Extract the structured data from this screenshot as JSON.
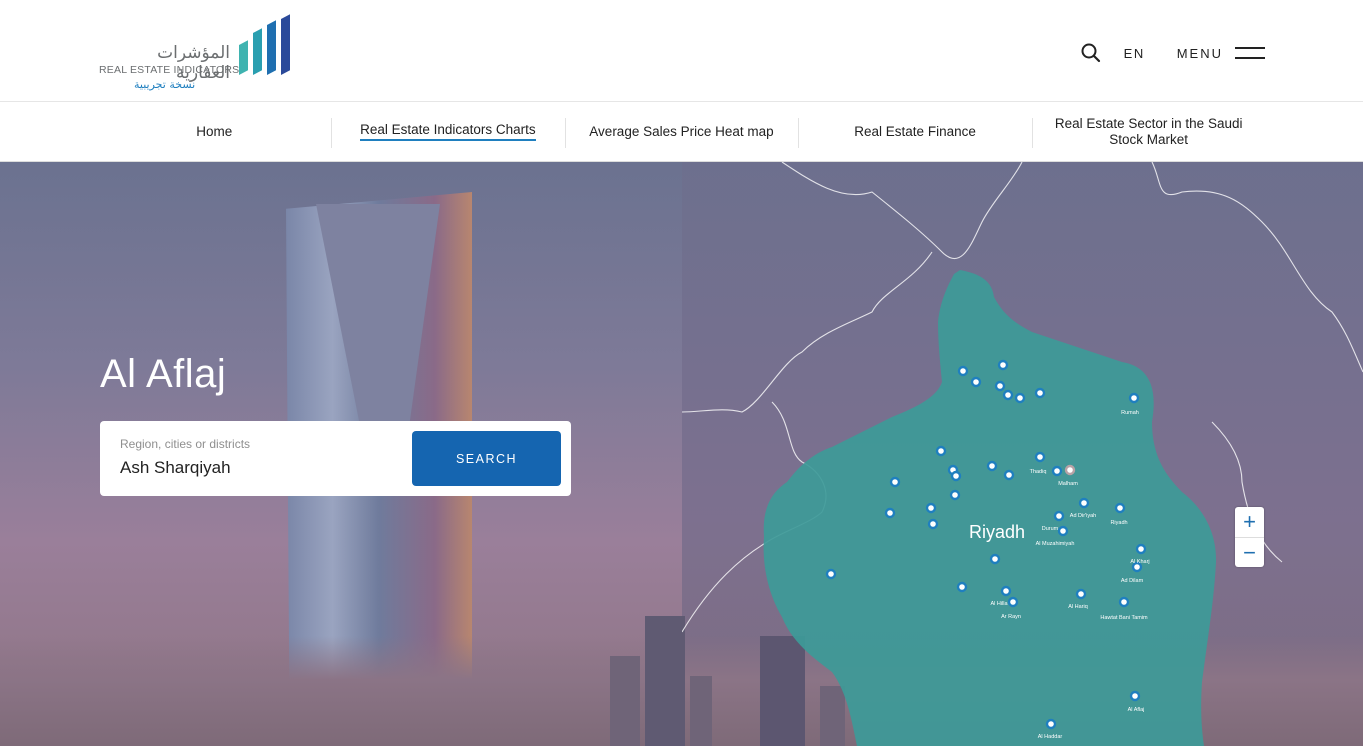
{
  "brand": {
    "name_ar": "المؤشرات العقارية",
    "name_en": "REAL ESTATE INDICATORS",
    "trial_ar": "نسخة تجريبية",
    "bar_colors": [
      "#3fb3b0",
      "#2a8fb5",
      "#1f6fb0",
      "#2b4a9a"
    ]
  },
  "header": {
    "search_icon": "search-icon",
    "lang": "EN",
    "menu": "MENU"
  },
  "nav": {
    "items": [
      {
        "label": "Home"
      },
      {
        "label": "Real Estate Indicators Charts",
        "active": true
      },
      {
        "label": "Average Sales Price Heat map"
      },
      {
        "label": "Real Estate Finance"
      },
      {
        "label": "Real Estate Sector in the Saudi Stock Market"
      }
    ]
  },
  "hero": {
    "title": "Al Aflaj",
    "search": {
      "placeholder": "Region, cities or districts",
      "value": "Ash Sharqiyah",
      "button": "SEARCH"
    }
  },
  "map": {
    "region_label": "Riyadh",
    "region_color": "#3d9a98",
    "pin_color": "#1f7fbf",
    "cities": [
      {
        "name": "Rumah"
      },
      {
        "name": "Thadiq"
      },
      {
        "name": "Malham"
      },
      {
        "name": "Ad Dir'iyah"
      },
      {
        "name": "Riyadh"
      },
      {
        "name": "Durum"
      },
      {
        "name": "Al Muzahimiyah"
      },
      {
        "name": "Al Kharj"
      },
      {
        "name": "Ad Dilam"
      },
      {
        "name": "Al Hilla"
      },
      {
        "name": "Ar Rayn"
      },
      {
        "name": "Al Hariq"
      },
      {
        "name": "Hawtat Bani Tamim"
      },
      {
        "name": "Al Aflaj"
      },
      {
        "name": "Al Haddar"
      }
    ],
    "zoom_in": "+",
    "zoom_out": "−"
  }
}
